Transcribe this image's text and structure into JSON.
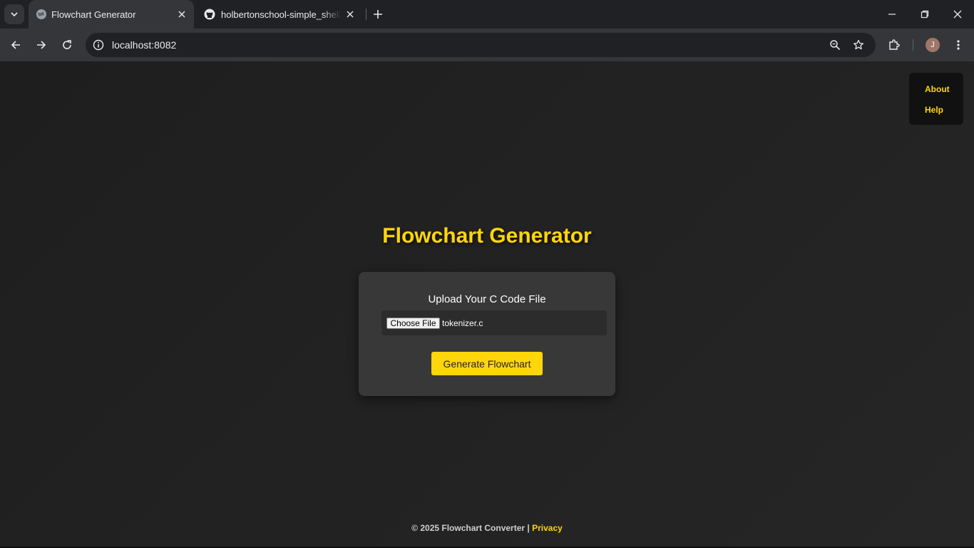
{
  "browser": {
    "tabs": [
      {
        "title": "Flowchart Generator",
        "active": true,
        "icon": "globe-icon"
      },
      {
        "title": "holbertonschool-simple_shell/p",
        "active": false,
        "icon": "github-icon"
      }
    ],
    "url": "localhost:8082",
    "profile_initial": "J"
  },
  "page": {
    "menu": {
      "about": "About",
      "help": "Help"
    },
    "title": "Flowchart Generator",
    "upload_label": "Upload Your C Code File",
    "file_input": {
      "button_label": "Choose File",
      "file_name": "tokenizer.c"
    },
    "generate_button": "Generate Flowchart",
    "footer": {
      "copyright": "© 2025 Flowchart Converter |",
      "privacy": "Privacy"
    }
  },
  "colors": {
    "accent": "#ffd60a",
    "background": "#202124",
    "card": "#383838"
  }
}
